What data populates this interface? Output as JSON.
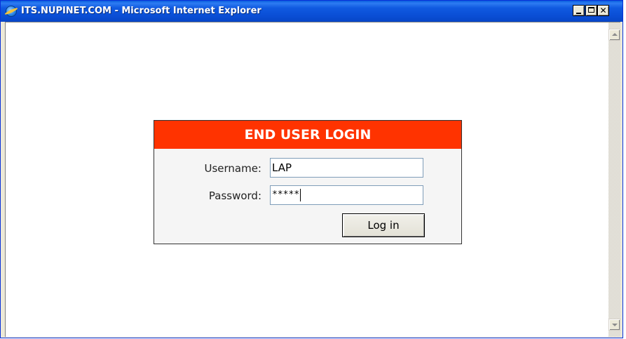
{
  "window": {
    "title": "ITS.NUPINET.COM - Microsoft Internet Explorer",
    "icon": "internet-explorer-icon",
    "controls": {
      "minimize_icon": "minimize-icon",
      "maximize_icon": "maximize-icon",
      "close_label": "✕"
    }
  },
  "login": {
    "header": "END USER LOGIN",
    "header_color": "#ff3300",
    "username_label": "Username:",
    "username_value": "LAP",
    "password_label": "Password:",
    "password_value": "*****",
    "submit_label": "Log in"
  }
}
